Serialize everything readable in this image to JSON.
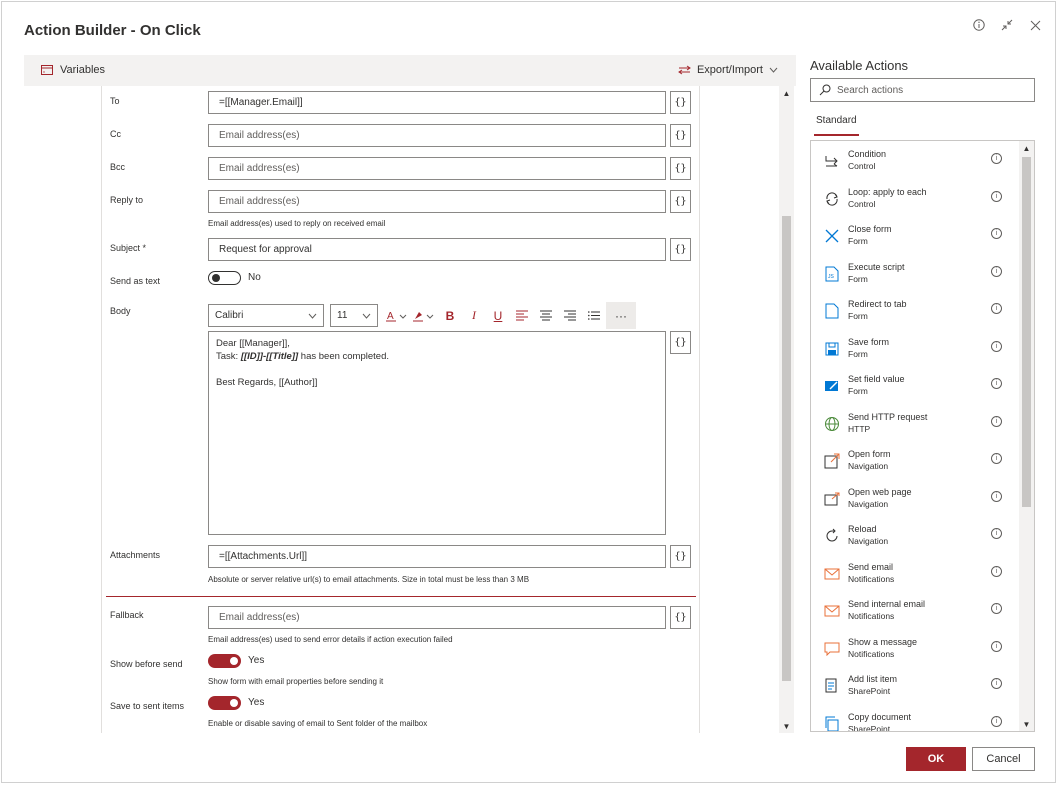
{
  "dialog": {
    "title": "Action Builder - On Click",
    "info_icon": "info-icon",
    "collapse_icon": "collapse-icon",
    "close_icon": "close-icon"
  },
  "toolbar": {
    "variables_label": "Variables",
    "export_label": "Export/Import"
  },
  "form": {
    "to": {
      "label": "To",
      "value": "=[[Manager.Email]]"
    },
    "cc": {
      "label": "Cc",
      "placeholder": "Email address(es)"
    },
    "bcc": {
      "label": "Bcc",
      "placeholder": "Email address(es)"
    },
    "reply_to": {
      "label": "Reply to",
      "placeholder": "Email address(es)",
      "hint": "Email address(es) used to reply on received email"
    },
    "subject": {
      "label": "Subject *",
      "value": "Request for approval"
    },
    "send_as_text": {
      "label": "Send as text",
      "state": "No"
    },
    "body": {
      "label": "Body",
      "font": "Calibri",
      "size": "11",
      "line1": "Dear [[Manager]],",
      "line2_prefix": "Task: ",
      "line2_bold": "[[ID]]-[[Title]]",
      "line2_suffix": " has been completed.",
      "line3": "Best Regards, [[Author]]"
    },
    "attachments": {
      "label": "Attachments",
      "value": "=[[Attachments.Url]]",
      "hint": "Absolute or server relative url(s) to email attachments. Size in total must be less than 3 MB"
    },
    "fallback": {
      "label": "Fallback",
      "placeholder": "Email address(es)",
      "hint": "Email address(es) used to send error details if action execution failed"
    },
    "show_before_send": {
      "label": "Show before send",
      "state": "Yes",
      "hint": "Show form with email properties before sending it"
    },
    "save_to_sent": {
      "label": "Save to sent items",
      "state": "Yes",
      "hint": "Enable or disable saving of email to Sent folder of the mailbox"
    },
    "brace_label": "{}"
  },
  "actions_panel": {
    "title": "Available Actions",
    "search_placeholder": "Search actions",
    "tab": "Standard",
    "items": [
      {
        "name": "Condition",
        "category": "Control",
        "icon": "condition-icon"
      },
      {
        "name": "Loop: apply to each",
        "category": "Control",
        "icon": "loop-icon"
      },
      {
        "name": "Close form",
        "category": "Form",
        "icon": "close-form-icon"
      },
      {
        "name": "Execute script",
        "category": "Form",
        "icon": "script-icon"
      },
      {
        "name": "Redirect to tab",
        "category": "Form",
        "icon": "redirect-tab-icon"
      },
      {
        "name": "Save form",
        "category": "Form",
        "icon": "save-icon"
      },
      {
        "name": "Set field value",
        "category": "Form",
        "icon": "set-field-icon"
      },
      {
        "name": "Send HTTP request",
        "category": "HTTP",
        "icon": "globe-icon"
      },
      {
        "name": "Open form",
        "category": "Navigation",
        "icon": "open-form-icon"
      },
      {
        "name": "Open web page",
        "category": "Navigation",
        "icon": "open-web-icon"
      },
      {
        "name": "Reload",
        "category": "Navigation",
        "icon": "reload-icon"
      },
      {
        "name": "Send email",
        "category": "Notifications",
        "icon": "email-icon"
      },
      {
        "name": "Send internal email",
        "category": "Notifications",
        "icon": "internal-email-icon"
      },
      {
        "name": "Show a message",
        "category": "Notifications",
        "icon": "message-icon"
      },
      {
        "name": "Add list item",
        "category": "SharePoint",
        "icon": "add-list-icon"
      },
      {
        "name": "Copy document",
        "category": "SharePoint",
        "icon": "copy-doc-icon"
      }
    ]
  },
  "footer": {
    "ok": "OK",
    "cancel": "Cancel"
  },
  "colors": {
    "accent": "#a4262c",
    "action_icon_blue": "#0078d4",
    "action_icon_orange": "#e8703a"
  }
}
